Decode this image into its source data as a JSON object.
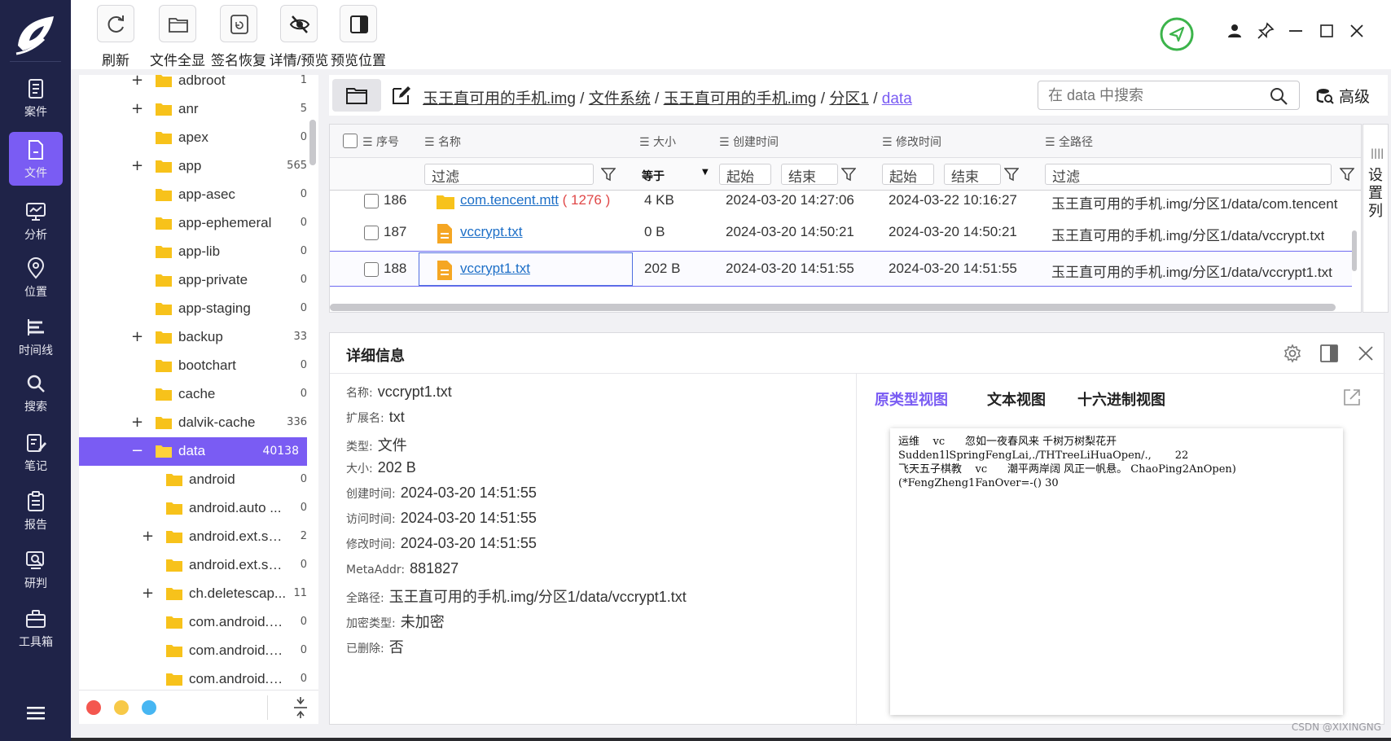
{
  "nav": {
    "items": [
      {
        "label": "案件",
        "icon": "case-icon"
      },
      {
        "label": "文件",
        "icon": "file-icon"
      },
      {
        "label": "分析",
        "icon": "analysis-icon"
      },
      {
        "label": "位置",
        "icon": "location-icon"
      },
      {
        "label": "时间线",
        "icon": "timeline-icon"
      },
      {
        "label": "搜索",
        "icon": "search-icon"
      },
      {
        "label": "笔记",
        "icon": "note-icon"
      },
      {
        "label": "报告",
        "icon": "report-icon"
      },
      {
        "label": "研判",
        "icon": "judge-icon"
      },
      {
        "label": "工具箱",
        "icon": "toolbox-icon"
      }
    ],
    "active": "文件"
  },
  "toolbar": {
    "refresh": "刷新",
    "show_all": "文件全显",
    "signature_restore": "签名恢复",
    "detail_preview": "详情/预览",
    "preview_position": "预览位置"
  },
  "tree": {
    "items": [
      {
        "name": "adbroot",
        "count": "1",
        "expand": "+"
      },
      {
        "name": "anr",
        "count": "5",
        "expand": "+"
      },
      {
        "name": "apex",
        "count": "0",
        "expand": ""
      },
      {
        "name": "app",
        "count": "565",
        "expand": "+"
      },
      {
        "name": "app-asec",
        "count": "0",
        "expand": ""
      },
      {
        "name": "app-ephemeral",
        "count": "0",
        "expand": ""
      },
      {
        "name": "app-lib",
        "count": "0",
        "expand": ""
      },
      {
        "name": "app-private",
        "count": "0",
        "expand": ""
      },
      {
        "name": "app-staging",
        "count": "0",
        "expand": ""
      },
      {
        "name": "backup",
        "count": "33",
        "expand": "+"
      },
      {
        "name": "bootchart",
        "count": "0",
        "expand": ""
      },
      {
        "name": "cache",
        "count": "0",
        "expand": ""
      },
      {
        "name": "dalvik-cache",
        "count": "336",
        "expand": "+"
      },
      {
        "name": "data",
        "count": "40138",
        "expand": "−"
      },
      {
        "name": "android",
        "count": "0",
        "expand": ""
      },
      {
        "name": "android.auto ...",
        "count": "0",
        "expand": ""
      },
      {
        "name": "android.ext.ser...",
        "count": "2",
        "expand": "+"
      },
      {
        "name": "android.ext.sh...",
        "count": "0",
        "expand": ""
      },
      {
        "name": "ch.deletescap...",
        "count": "11",
        "expand": "+"
      },
      {
        "name": "com.android.a...",
        "count": "0",
        "expand": ""
      },
      {
        "name": "com.android.b...",
        "count": "0",
        "expand": ""
      },
      {
        "name": "com.android.bi...",
        "count": "0",
        "expand": ""
      }
    ]
  },
  "breadcrumb": [
    "玉王直可用的手机.img",
    "文件系统",
    "玉王直可用的手机.img",
    "分区1",
    "data"
  ],
  "search": {
    "placeholder": "在 data 中搜索"
  },
  "advanced_label": "高级",
  "grid": {
    "headers": {
      "seq": "序号",
      "name": "名称",
      "size": "大小",
      "created": "创建时间",
      "modified": "修改时间",
      "path": "全路径"
    },
    "filters": {
      "filter": "过滤",
      "equals": "等于",
      "start": "起始",
      "end": "结束"
    },
    "rows": [
      {
        "seq": "186",
        "name": "com.tencent.mtt",
        "badge": "( 1276 )",
        "size": "4 KB",
        "created": "2024-03-20 14:27:06",
        "modified": "2024-03-22 10:16:27",
        "path": "玉王直可用的手机.img/分区1/data/com.tencent.mtt",
        "type": "folder"
      },
      {
        "seq": "187",
        "name": "vccrypt.txt",
        "badge": "",
        "size": "0 B",
        "created": "2024-03-20 14:50:21",
        "modified": "2024-03-20 14:50:21",
        "path": "玉王直可用的手机.img/分区1/data/vccrypt.txt",
        "type": "file"
      },
      {
        "seq": "188",
        "name": "vccrypt1.txt",
        "badge": "",
        "size": "202 B",
        "created": "2024-03-20 14:51:55",
        "modified": "2024-03-20 14:51:55",
        "path": "玉王直可用的手机.img/分区1/data/vccrypt1.txt",
        "type": "file"
      }
    ],
    "settings_label": "设置列"
  },
  "detail": {
    "title": "详细信息",
    "props": [
      {
        "k": "名称:",
        "v": "vccrypt1.txt"
      },
      {
        "k": "扩展名:",
        "v": "txt"
      },
      {
        "k": "类型:",
        "v": "文件"
      },
      {
        "k": "大小:",
        "v": "202 B"
      },
      {
        "k": "创建时间:",
        "v": "2024-03-20 14:51:55"
      },
      {
        "k": "访问时间:",
        "v": "2024-03-20 14:51:55"
      },
      {
        "k": "修改时间:",
        "v": "2024-03-20 14:51:55"
      },
      {
        "k": "MetaAddr:",
        "v": "881827"
      },
      {
        "k": "全路径:",
        "v": "玉王直可用的手机.img/分区1/data/vccrypt1.txt"
      },
      {
        "k": "加密类型:",
        "v": "未加密"
      },
      {
        "k": "已删除:",
        "v": "否"
      }
    ],
    "tabs": [
      "原类型视图",
      "文本视图",
      "十六进制视图"
    ],
    "active_tab": "原类型视图",
    "preview_text": "运维    vc      忽如一夜春风来 千树万树梨花开\nSudden1lSpringFengLai,./THTreeLiHuaOpen/.,       22\n飞天五子棋教    vc      潮平两岸阔 风正一帆悬。 ChaoPing2AnOpen)\n(*FengZheng1FanOver=-() 30"
  },
  "watermark": "CSDN @XIXINGNG",
  "colors": {
    "accent": "#7a5cf3",
    "nav_bg": "#1f2348",
    "folder": "#f7c21b",
    "link": "#1d6fc7",
    "badge": "#e04848",
    "status_ok": "#3cb44b"
  }
}
